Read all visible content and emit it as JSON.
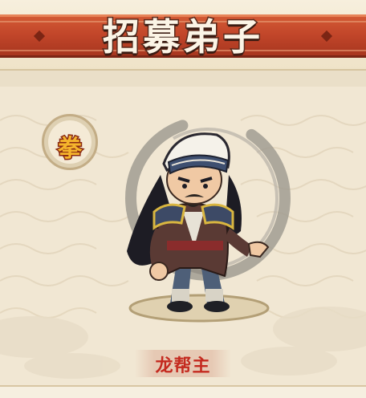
{
  "header": {
    "title": "招募弟子"
  },
  "weapon_badge": {
    "label": "拳",
    "icon": "fist-glyph-icon"
  },
  "character": {
    "name": "龙帮主"
  },
  "colors": {
    "banner_red": "#c2462a",
    "name_red": "#c42a1f",
    "badge_gold": "#f5b52c"
  }
}
